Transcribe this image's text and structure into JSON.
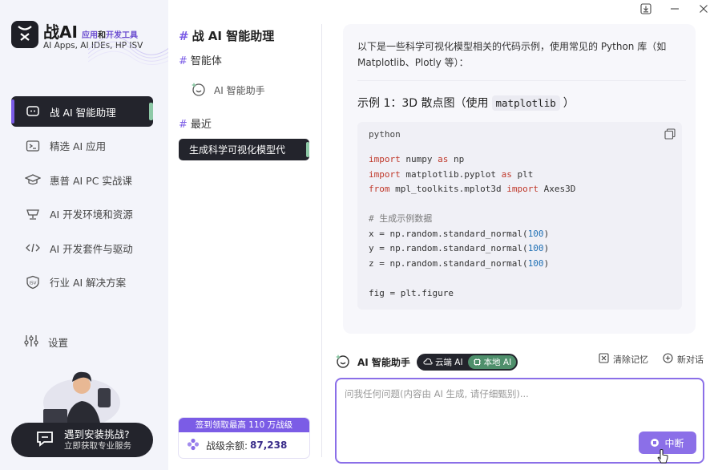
{
  "brand": {
    "name": "战AI",
    "tag_part1": "应用",
    "tag_and": "和",
    "tag_part2": "开发工具",
    "subtitle": "AI Apps, AI IDEs, HP ISV"
  },
  "sidebar": {
    "items": [
      {
        "label": "战 AI 智能助理",
        "icon": "chat-bot-icon",
        "active": true
      },
      {
        "label": "精选 AI 应用",
        "icon": "terminal-icon"
      },
      {
        "label": "惠普 AI PC 实战课",
        "icon": "graduation-cap-icon"
      },
      {
        "label": "AI 开发环境和资源",
        "icon": "monitor-icon"
      },
      {
        "label": "AI 开发套件与驱动",
        "icon": "code-icon"
      },
      {
        "label": "行业 AI 解决方案",
        "icon": "isv-shield-icon"
      }
    ],
    "settings_label": "设置",
    "help_title": "遇到安装挑战?",
    "help_subtitle": "立即获取专业服务"
  },
  "middle": {
    "title": "战 AI 智能助理",
    "agents_section": "智能体",
    "agent_item": "AI 智能助手",
    "recent_section": "最近",
    "recent_item": "生成科学可视化模型代",
    "reward_banner": "签到领取最高 110 万战级",
    "reward_label": "战级余额:",
    "reward_value": "87,238"
  },
  "chat": {
    "intro": "以下是一些科学可视化模型相关的代码示例，使用常见的 Python 库（如 Matplotlib、Plotly 等）：",
    "example_title_prefix": "示例 1：3D 散点图（使用",
    "example_title_code": "matplotlib",
    "example_title_suffix": "）",
    "code_language": "python",
    "code": {
      "l1_kw": "import",
      "l1_rest": " numpy ",
      "l1_kw2": "as",
      "l1_end": " np",
      "l2_kw": "import",
      "l2_rest": " matplotlib.pyplot ",
      "l2_kw2": "as",
      "l2_end": " plt",
      "l3_kw": "from",
      "l3_rest": " mpl_toolkits.mplot3d ",
      "l3_kw2": "import",
      "l3_end": " Axes3D",
      "l5_comment": "# 生成示例数据",
      "l6_pre": "x = np.random.standard_normal(",
      "l6_num": "100",
      "l6_post": ")",
      "l7_pre": "y = np.random.standard_normal(",
      "l7_num": "100",
      "l7_post": ")",
      "l8_pre": "z = np.random.standard_normal(",
      "l8_num": "100",
      "l8_post": ")",
      "l10": "fig = plt.figure"
    }
  },
  "assistant_bar": {
    "label": "AI 智能助手",
    "mode_cloud": "云端 AI",
    "mode_local": "本地 AI",
    "clear_label": "清除记忆",
    "new_chat_label": "新对话"
  },
  "input": {
    "placeholder": "问我任何问题(内容由 AI 生成, 请仔细甄别)...",
    "stop_label": "中断"
  },
  "colors": {
    "accent": "#8b6fe8",
    "dark": "#23242c",
    "green_indicator": "#8ec9a7"
  }
}
